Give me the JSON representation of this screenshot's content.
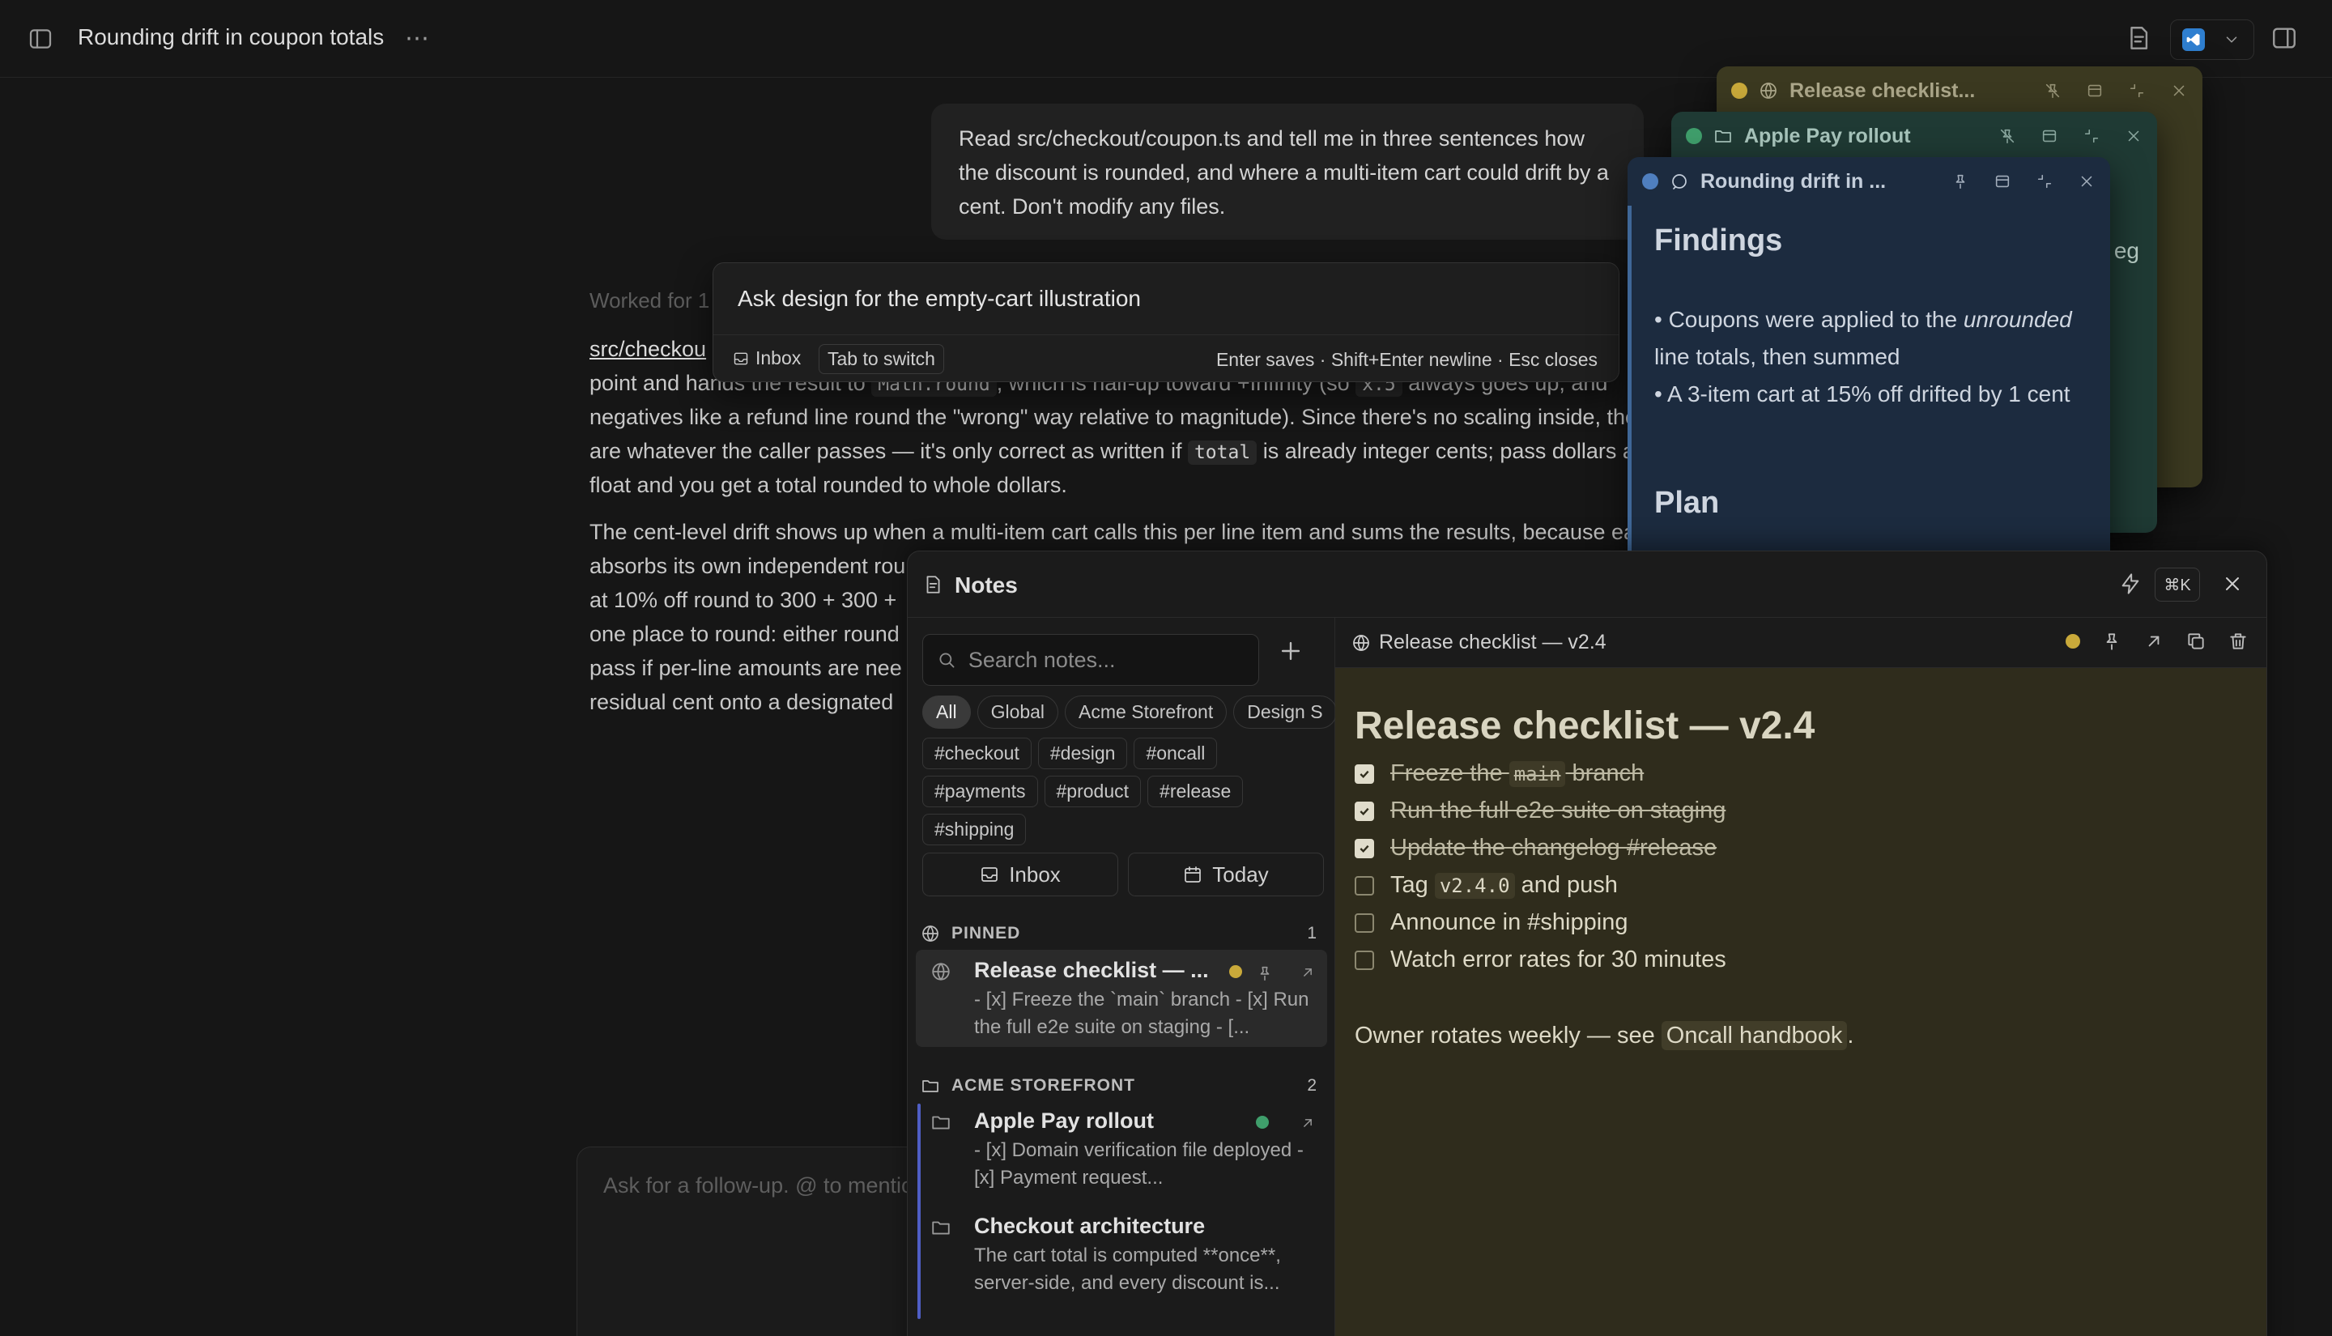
{
  "topbar": {
    "title": "Rounding drift in coupon totals"
  },
  "chat": {
    "user_message": "Read src/checkout/coupon.ts and tell me in three sentences how the discount is rounded, and where a multi-item cart could drift by a cent. Don't modify any files.",
    "worked_for": "Worked for 1",
    "p1_l1_link": "src/checkou",
    "p1_l2a": "point and hands the result to ",
    "p1_l2_code": "Math.round",
    "p1_l2b": ", which is half-up toward +Infinity (so ",
    "p1_l2_code2": "x.5",
    "p1_l2c": " always goes up, and",
    "p1_l3": "negatives like a refund line round the \"wrong\" way relative to magnitude). Since there's no scaling inside, the units",
    "p1_l4a": "are whatever the caller passes — it's only correct as written if ",
    "p1_l4_code": "total",
    "p1_l4b": " is already integer cents; pass dollars as a",
    "p1_l5": "float and you get a total rounded to whole dollars.",
    "p2_l1": "The cent-level drift shows up when a multi-item cart calls this per line item and sums the results, because each line",
    "p2_l2": "absorbs its own independent rou",
    "p2_l3": "at 10% off round to 300 + 300 +",
    "p2_l4": "one place to round: either round",
    "p2_l5": "pass if per-line amounts are nee",
    "p2_l6": "residual cent onto a designated",
    "composer_placeholder": "Ask for a follow-up. @ to mention"
  },
  "capture": {
    "text": "Ask design for the empty-cart illustration",
    "destination": "Inbox",
    "switch_hint": "Tab to switch",
    "hints": "Enter saves · Shift+Enter newline · Esc closes"
  },
  "floating": [
    {
      "title": "Release checklist...",
      "color": "#c9a93a"
    },
    {
      "title": "Apple Pay rollout",
      "color": "#3f9e6b",
      "peek": "eg"
    },
    {
      "title": "Rounding drift in ...",
      "color": "#4f7fbf",
      "heading": "Findings",
      "b1_pre": "• Coupons were applied to the ",
      "b1_em": "unrounded",
      "b1_post": " line totals, then summed",
      "b2": "• A 3-item cart at 15% off drifted by 1 cent",
      "heading2": "Plan"
    }
  ],
  "notes": {
    "title": "Notes",
    "shortcut": "⌘K",
    "search_placeholder": "Search notes...",
    "filters": [
      {
        "label": "All",
        "active": true
      },
      {
        "label": "Global"
      },
      {
        "label": "Acme Storefront"
      },
      {
        "label": "Design S"
      }
    ],
    "tags": [
      "#checkout",
      "#design",
      "#oncall",
      "#payments",
      "#product",
      "#release",
      "#shipping"
    ],
    "inbox_label": "Inbox",
    "today_label": "Today",
    "pinned": {
      "label": "PINNED",
      "count": "1"
    },
    "pinned_item": {
      "title": "Release checklist — ...",
      "preview": "- [x] Freeze the `main` branch - [x] Run the full e2e suite on staging - [...",
      "dot": "#c9a93a"
    },
    "acme": {
      "label": "ACME STOREFRONT",
      "count": "2"
    },
    "acme_items": [
      {
        "title": "Apple Pay rollout",
        "preview": "- [x] Domain verification file deployed - [x] Payment request...",
        "dot": "#3f9e6b"
      },
      {
        "title": "Checkout architecture",
        "preview": "The cart total is computed **once**, server-side, and every discount is..."
      }
    ]
  },
  "editor": {
    "crumb": "Release checklist — v2.4",
    "status_color": "#c9a93a",
    "heading": "Release checklist — v2.4",
    "t1_pre": "Freeze the ",
    "t1_code": "main",
    "t1_post": " branch",
    "t1_done": true,
    "t2": "Run the full e2e suite on staging",
    "t2_done": true,
    "t3": "Update the changelog #release",
    "t3_done": true,
    "t4_pre": "Tag ",
    "t4_code": "v2.4.0",
    "t4_post": " and push",
    "t4_done": false,
    "t5": "Announce in #shipping",
    "t5_done": false,
    "t6": "Watch error rates for 30 minutes",
    "t6_done": false,
    "owner_pre": "Owner rotates weekly — see ",
    "owner_link": "Oncall handbook",
    "owner_post": "."
  }
}
